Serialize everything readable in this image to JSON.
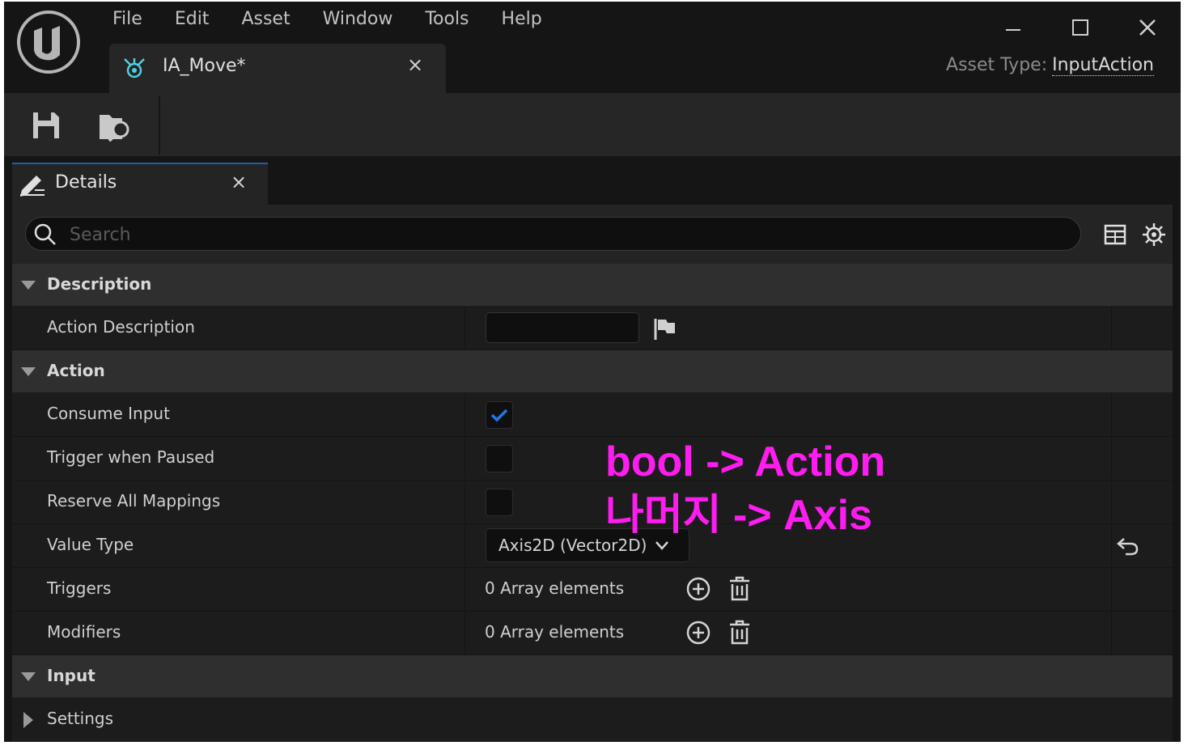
{
  "menu": [
    "File",
    "Edit",
    "Asset",
    "Window",
    "Tools",
    "Help"
  ],
  "document_tab": {
    "label": "IA_Move*",
    "close": "×",
    "icon": "input-action-icon"
  },
  "asset_type": {
    "label": "Asset Type:",
    "value": "InputAction"
  },
  "toolbar": {
    "save_icon": "save-icon",
    "browse_icon": "browse-asset-icon"
  },
  "details_tab": {
    "label": "Details",
    "close": "×",
    "icon": "details-pencil-icon"
  },
  "search": {
    "placeholder": "Search"
  },
  "sections": {
    "description": {
      "label": "Description",
      "action_description": {
        "label": "Action Description",
        "value": ""
      }
    },
    "action": {
      "label": "Action",
      "consume_input": {
        "label": "Consume Input",
        "checked": true
      },
      "trigger_when_paused": {
        "label": "Trigger when Paused",
        "checked": false
      },
      "reserve_all_mappings": {
        "label": "Reserve All Mappings",
        "checked": false
      },
      "value_type": {
        "label": "Value Type",
        "value": "Axis2D (Vector2D)"
      },
      "triggers": {
        "label": "Triggers",
        "value": "0 Array elements"
      },
      "modifiers": {
        "label": "Modifiers",
        "value": "0 Array elements"
      }
    },
    "input": {
      "label": "Input",
      "settings": {
        "label": "Settings"
      }
    }
  },
  "annotation": {
    "line1": "bool -> Action",
    "line2": "나머지 -> Axis",
    "color": "#ff1cf0"
  },
  "colors": {
    "accent_blue": "#1f78e6",
    "background": "#151515",
    "panel": "#242424"
  }
}
